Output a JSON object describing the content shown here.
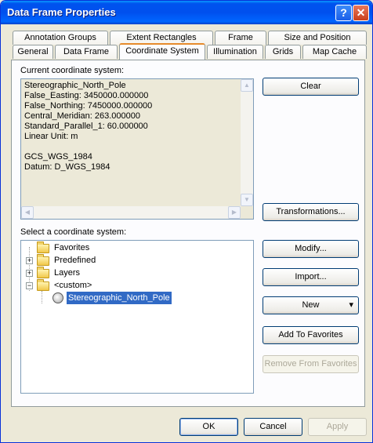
{
  "window": {
    "title": "Data Frame Properties",
    "help_glyph": "?",
    "close_glyph": "✕"
  },
  "tabs": {
    "row1": [
      "Annotation Groups",
      "Extent Rectangles",
      "Frame",
      "Size and Position"
    ],
    "row2": [
      "General",
      "Data Frame",
      "Coordinate System",
      "Illumination",
      "Grids",
      "Map Cache"
    ],
    "active": "Coordinate System"
  },
  "current": {
    "label": "Current coordinate system:",
    "text": "Stereographic_North_Pole\nFalse_Easting: 3450000.000000\nFalse_Northing: 7450000.000000\nCentral_Meridian: 263.000000\nStandard_Parallel_1: 60.000000\nLinear Unit: m\n\nGCS_WGS_1984\nDatum: D_WGS_1984",
    "clear_button": "Clear",
    "transformations_button": "Transformations..."
  },
  "select": {
    "label": "Select a coordinate system:",
    "tree": [
      {
        "label": "Favorites",
        "expander": ""
      },
      {
        "label": "Predefined",
        "expander": "+"
      },
      {
        "label": "Layers",
        "expander": "+"
      },
      {
        "label": "<custom>",
        "expander": "−"
      },
      {
        "label": "Stereographic_North_Pole",
        "expander": ""
      }
    ],
    "modify_button": "Modify...",
    "import_button": "Import...",
    "new_button": "New",
    "add_favorites_button": "Add To Favorites",
    "remove_favorites_button": "Remove From Favorites"
  },
  "footer": {
    "ok": "OK",
    "cancel": "Cancel",
    "apply": "Apply"
  },
  "icons": {
    "dropdown": "▾",
    "scroll_up": "▲",
    "scroll_down": "▼",
    "scroll_left": "◀",
    "scroll_right": "▶"
  }
}
